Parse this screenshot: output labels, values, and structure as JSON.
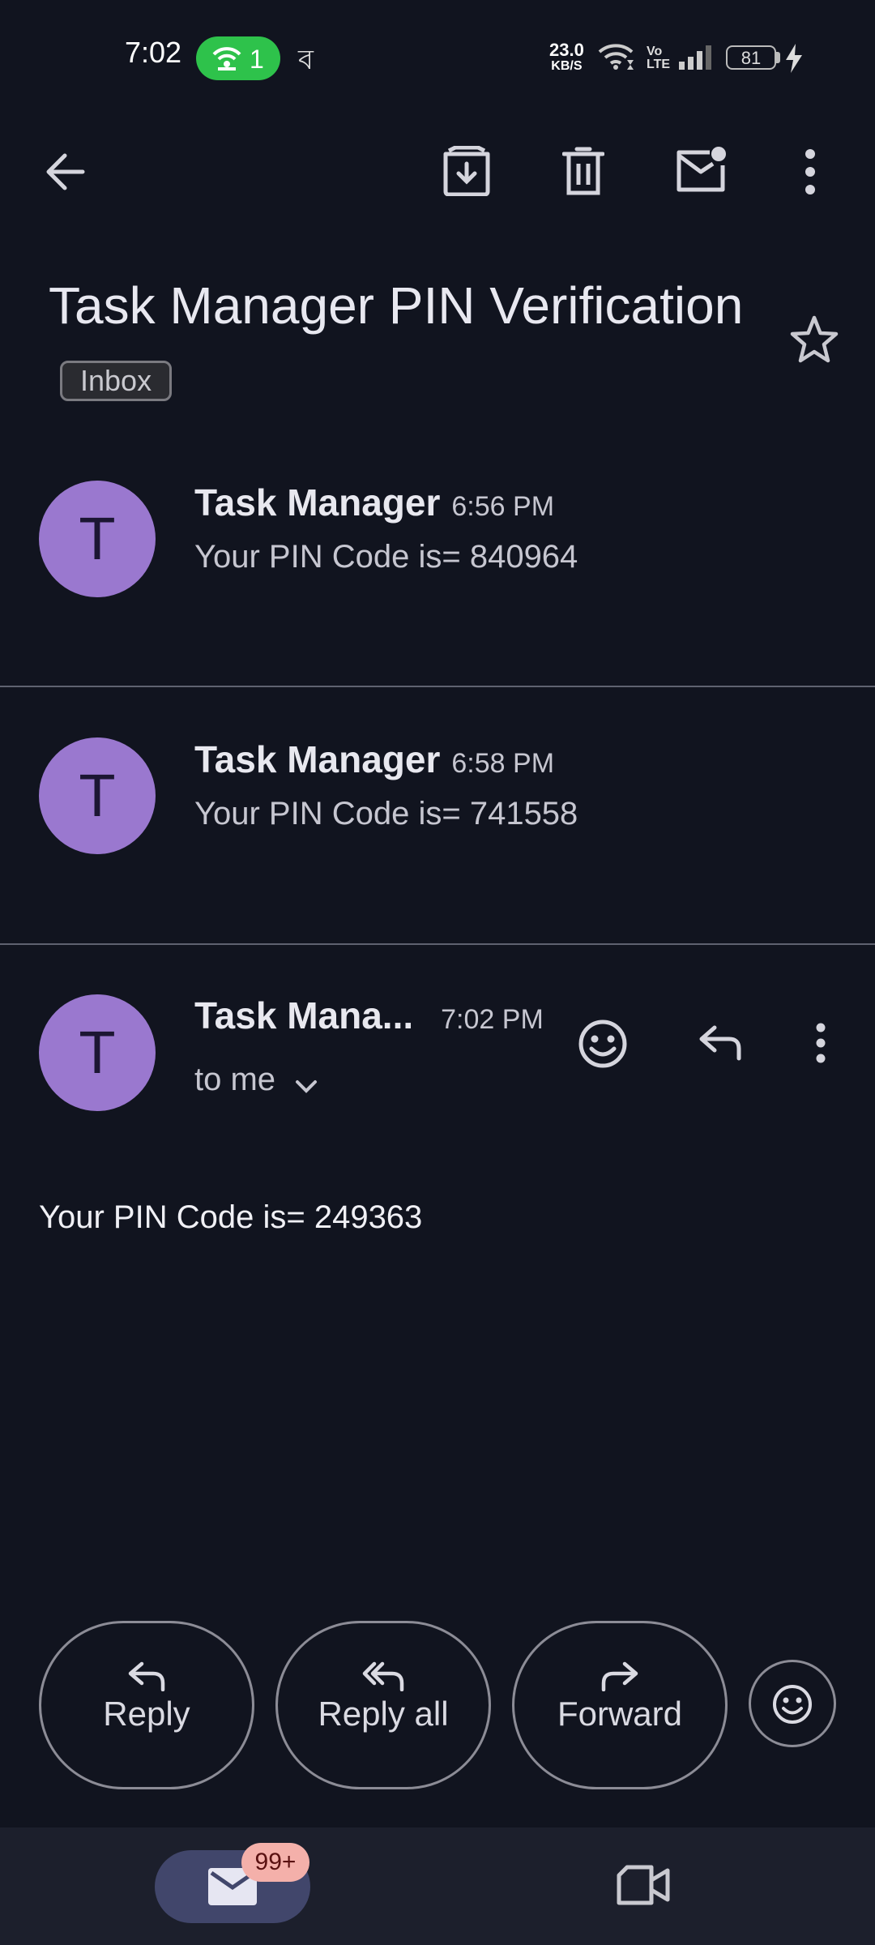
{
  "status_bar": {
    "time": "7:02",
    "hotspot_count": "1",
    "bengali_glyph": "ব",
    "net_speed_value": "23.0",
    "net_speed_unit": "KB/S",
    "volte": "Vo\nLTE",
    "battery": "81"
  },
  "toolbar": {
    "icons": [
      "back-arrow-icon",
      "archive-icon",
      "delete-icon",
      "mark-unread-icon",
      "more-vert-icon"
    ]
  },
  "thread": {
    "subject": "Task Manager PIN Verification",
    "label": "Inbox",
    "starred": false
  },
  "messages": [
    {
      "avatar_letter": "T",
      "sender": "Task Manager",
      "time": "6:56 PM",
      "snippet": "Your PIN Code is= 840964"
    },
    {
      "avatar_letter": "T",
      "sender": "Task Manager",
      "time": "6:58 PM",
      "snippet": "Your PIN Code is= 741558"
    }
  ],
  "open_message": {
    "avatar_letter": "T",
    "sender": "Task Mana...",
    "time": "7:02 PM",
    "recipient": "to me",
    "body": "Your PIN Code is= 249363"
  },
  "actions": {
    "reply": "Reply",
    "reply_all": "Reply all",
    "forward": "Forward"
  },
  "bottom_nav": {
    "mail_badge": "99+"
  },
  "colors": {
    "background": "#11141f",
    "avatar": "#9a78cf",
    "hotspot": "#2ec24b",
    "badge": "#f4b0aa"
  }
}
